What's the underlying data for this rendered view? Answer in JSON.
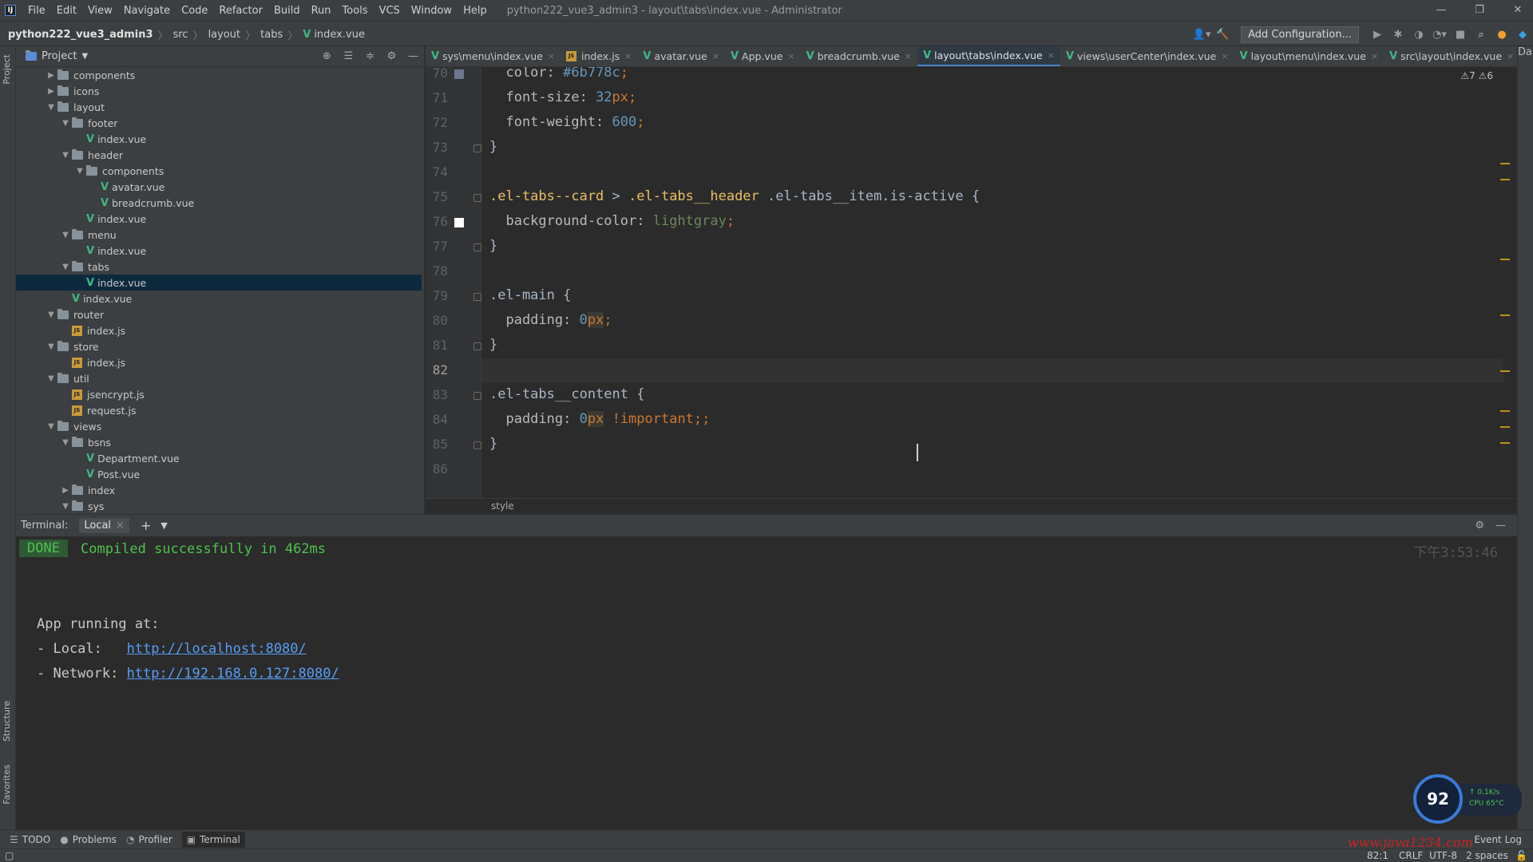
{
  "menubar": {
    "logo": "IJ",
    "items": [
      "File",
      "Edit",
      "View",
      "Navigate",
      "Code",
      "Refactor",
      "Build",
      "Run",
      "Tools",
      "VCS",
      "Window",
      "Help"
    ],
    "title": "python222_vue3_admin3 - layout\\tabs\\index.vue - Administrator",
    "window_controls": [
      "—",
      "❐",
      "✕"
    ]
  },
  "navbar": {
    "crumbs": [
      "python222_vue3_admin3",
      "src",
      "layout",
      "tabs",
      "index.vue"
    ],
    "add_configuration": "Add Configuration..."
  },
  "project_panel": {
    "title": "Project",
    "tree": [
      {
        "label": "components",
        "depth": 2,
        "kind": "folder",
        "expanded": false
      },
      {
        "label": "icons",
        "depth": 2,
        "kind": "folder",
        "expanded": false
      },
      {
        "label": "layout",
        "depth": 2,
        "kind": "folder",
        "expanded": true
      },
      {
        "label": "footer",
        "depth": 3,
        "kind": "folder",
        "expanded": true
      },
      {
        "label": "index.vue",
        "depth": 4,
        "kind": "vue"
      },
      {
        "label": "header",
        "depth": 3,
        "kind": "folder",
        "expanded": true
      },
      {
        "label": "components",
        "depth": 4,
        "kind": "folder",
        "expanded": true
      },
      {
        "label": "avatar.vue",
        "depth": 5,
        "kind": "vue"
      },
      {
        "label": "breadcrumb.vue",
        "depth": 5,
        "kind": "vue"
      },
      {
        "label": "index.vue",
        "depth": 4,
        "kind": "vue"
      },
      {
        "label": "menu",
        "depth": 3,
        "kind": "folder",
        "expanded": true
      },
      {
        "label": "index.vue",
        "depth": 4,
        "kind": "vue"
      },
      {
        "label": "tabs",
        "depth": 3,
        "kind": "folder",
        "expanded": true
      },
      {
        "label": "index.vue",
        "depth": 4,
        "kind": "vue",
        "selected": true
      },
      {
        "label": "index.vue",
        "depth": 3,
        "kind": "vue"
      },
      {
        "label": "router",
        "depth": 2,
        "kind": "folder",
        "expanded": true
      },
      {
        "label": "index.js",
        "depth": 3,
        "kind": "js"
      },
      {
        "label": "store",
        "depth": 2,
        "kind": "folder",
        "expanded": true
      },
      {
        "label": "index.js",
        "depth": 3,
        "kind": "js"
      },
      {
        "label": "util",
        "depth": 2,
        "kind": "folder",
        "expanded": true
      },
      {
        "label": "jsencrypt.js",
        "depth": 3,
        "kind": "js"
      },
      {
        "label": "request.js",
        "depth": 3,
        "kind": "js"
      },
      {
        "label": "views",
        "depth": 2,
        "kind": "folder",
        "expanded": true
      },
      {
        "label": "bsns",
        "depth": 3,
        "kind": "folder",
        "expanded": true
      },
      {
        "label": "Department.vue",
        "depth": 4,
        "kind": "vue"
      },
      {
        "label": "Post.vue",
        "depth": 4,
        "kind": "vue"
      },
      {
        "label": "index",
        "depth": 3,
        "kind": "folder",
        "expanded": false
      },
      {
        "label": "sys",
        "depth": 3,
        "kind": "folder",
        "expanded": true
      }
    ]
  },
  "editor_tabs": [
    {
      "label": "sys\\menu\\index.vue",
      "kind": "vue"
    },
    {
      "label": "index.js",
      "kind": "js"
    },
    {
      "label": "avatar.vue",
      "kind": "vue"
    },
    {
      "label": "App.vue",
      "kind": "vue"
    },
    {
      "label": "breadcrumb.vue",
      "kind": "vue"
    },
    {
      "label": "layout\\tabs\\index.vue",
      "kind": "vue",
      "active": true
    },
    {
      "label": "views\\userCenter\\index.vue",
      "kind": "vue"
    },
    {
      "label": "layout\\menu\\index.vue",
      "kind": "vue"
    },
    {
      "label": "src\\layout\\index.vue",
      "kind": "vue"
    }
  ],
  "editor": {
    "warnings": "⚠7 ⚠6",
    "lines": [
      {
        "n": "70",
        "tokens": [
          [
            "p",
            "  color: "
          ],
          [
            "v",
            "#6b778c"
          ],
          [
            "k",
            ";"
          ]
        ],
        "swatch": "#6b778c"
      },
      {
        "n": "71",
        "tokens": [
          [
            "p",
            "  font-size: "
          ],
          [
            "v",
            "32"
          ],
          [
            "k",
            "px;"
          ]
        ]
      },
      {
        "n": "72",
        "tokens": [
          [
            "p",
            "  font-weight: "
          ],
          [
            "v",
            "600"
          ],
          [
            "k",
            ";"
          ]
        ]
      },
      {
        "n": "73",
        "tokens": [
          [
            "g",
            "}"
          ]
        ],
        "fold": true
      },
      {
        "n": "74",
        "tokens": []
      },
      {
        "n": "75",
        "tokens": [
          [
            "s",
            ".el-tabs--card"
          ],
          [
            "g",
            " > "
          ],
          [
            "s",
            ".el-tabs__header"
          ],
          [
            "g",
            " .el-tabs__item.is-active {"
          ]
        ],
        "fold": true
      },
      {
        "n": "76",
        "tokens": [
          [
            "p",
            "  background-color: "
          ],
          [
            "h",
            "lightgray"
          ],
          [
            "k",
            ";"
          ]
        ],
        "swatch": "#ffffff"
      },
      {
        "n": "77",
        "tokens": [
          [
            "g",
            "}"
          ]
        ],
        "fold": true
      },
      {
        "n": "78",
        "tokens": []
      },
      {
        "n": "79",
        "tokens": [
          [
            "g",
            ".el-main {"
          ]
        ],
        "fold": true
      },
      {
        "n": "80",
        "tokens": [
          [
            "p",
            "  padding: "
          ],
          [
            "v",
            "0"
          ],
          [
            "kh",
            "px"
          ],
          [
            "k",
            ";"
          ]
        ]
      },
      {
        "n": "81",
        "tokens": [
          [
            "g",
            "}"
          ]
        ],
        "fold": true
      },
      {
        "n": "82",
        "tokens": [],
        "current": true
      },
      {
        "n": "83",
        "tokens": [
          [
            "g",
            ".el-tabs__content {"
          ]
        ],
        "fold": true
      },
      {
        "n": "84",
        "tokens": [
          [
            "p",
            "  padding: "
          ],
          [
            "v",
            "0"
          ],
          [
            "kh",
            "px"
          ],
          [
            "k",
            " !important;;"
          ]
        ]
      },
      {
        "n": "85",
        "tokens": [
          [
            "g",
            "}"
          ]
        ],
        "fold": true
      },
      {
        "n": "86",
        "tokens": []
      }
    ],
    "breadcrumb": "style"
  },
  "terminal": {
    "label": "Terminal:",
    "tab": "Local",
    "done": "DONE",
    "message": "Compiled successfully in 462ms",
    "time": "下午3:53:46",
    "app_running": "App running at:",
    "local_label": "- Local:   ",
    "local_url": "http://localhost:8080/",
    "network_label": "- Network: ",
    "network_url": "http://192.168.0.127:8080/"
  },
  "bottom_tools": [
    {
      "label": "TODO",
      "icon": "☰"
    },
    {
      "label": "Problems",
      "icon": "●"
    },
    {
      "label": "Profiler",
      "icon": "◔"
    },
    {
      "label": "Terminal",
      "icon": "▣",
      "active": true
    }
  ],
  "event_log": "Event Log",
  "status": {
    "position": "82:1",
    "line_sep": "CRLF",
    "encoding": "UTF-8",
    "indent": "2 spaces"
  },
  "side_labels": {
    "project": "Project",
    "structure": "Structure",
    "favorites": "Favorites",
    "database": "Database"
  },
  "widget": {
    "value": "92",
    "net": "↑ 0.1K/s",
    "cpu": "CPU 65°C"
  },
  "watermark": "www.java1234.com"
}
